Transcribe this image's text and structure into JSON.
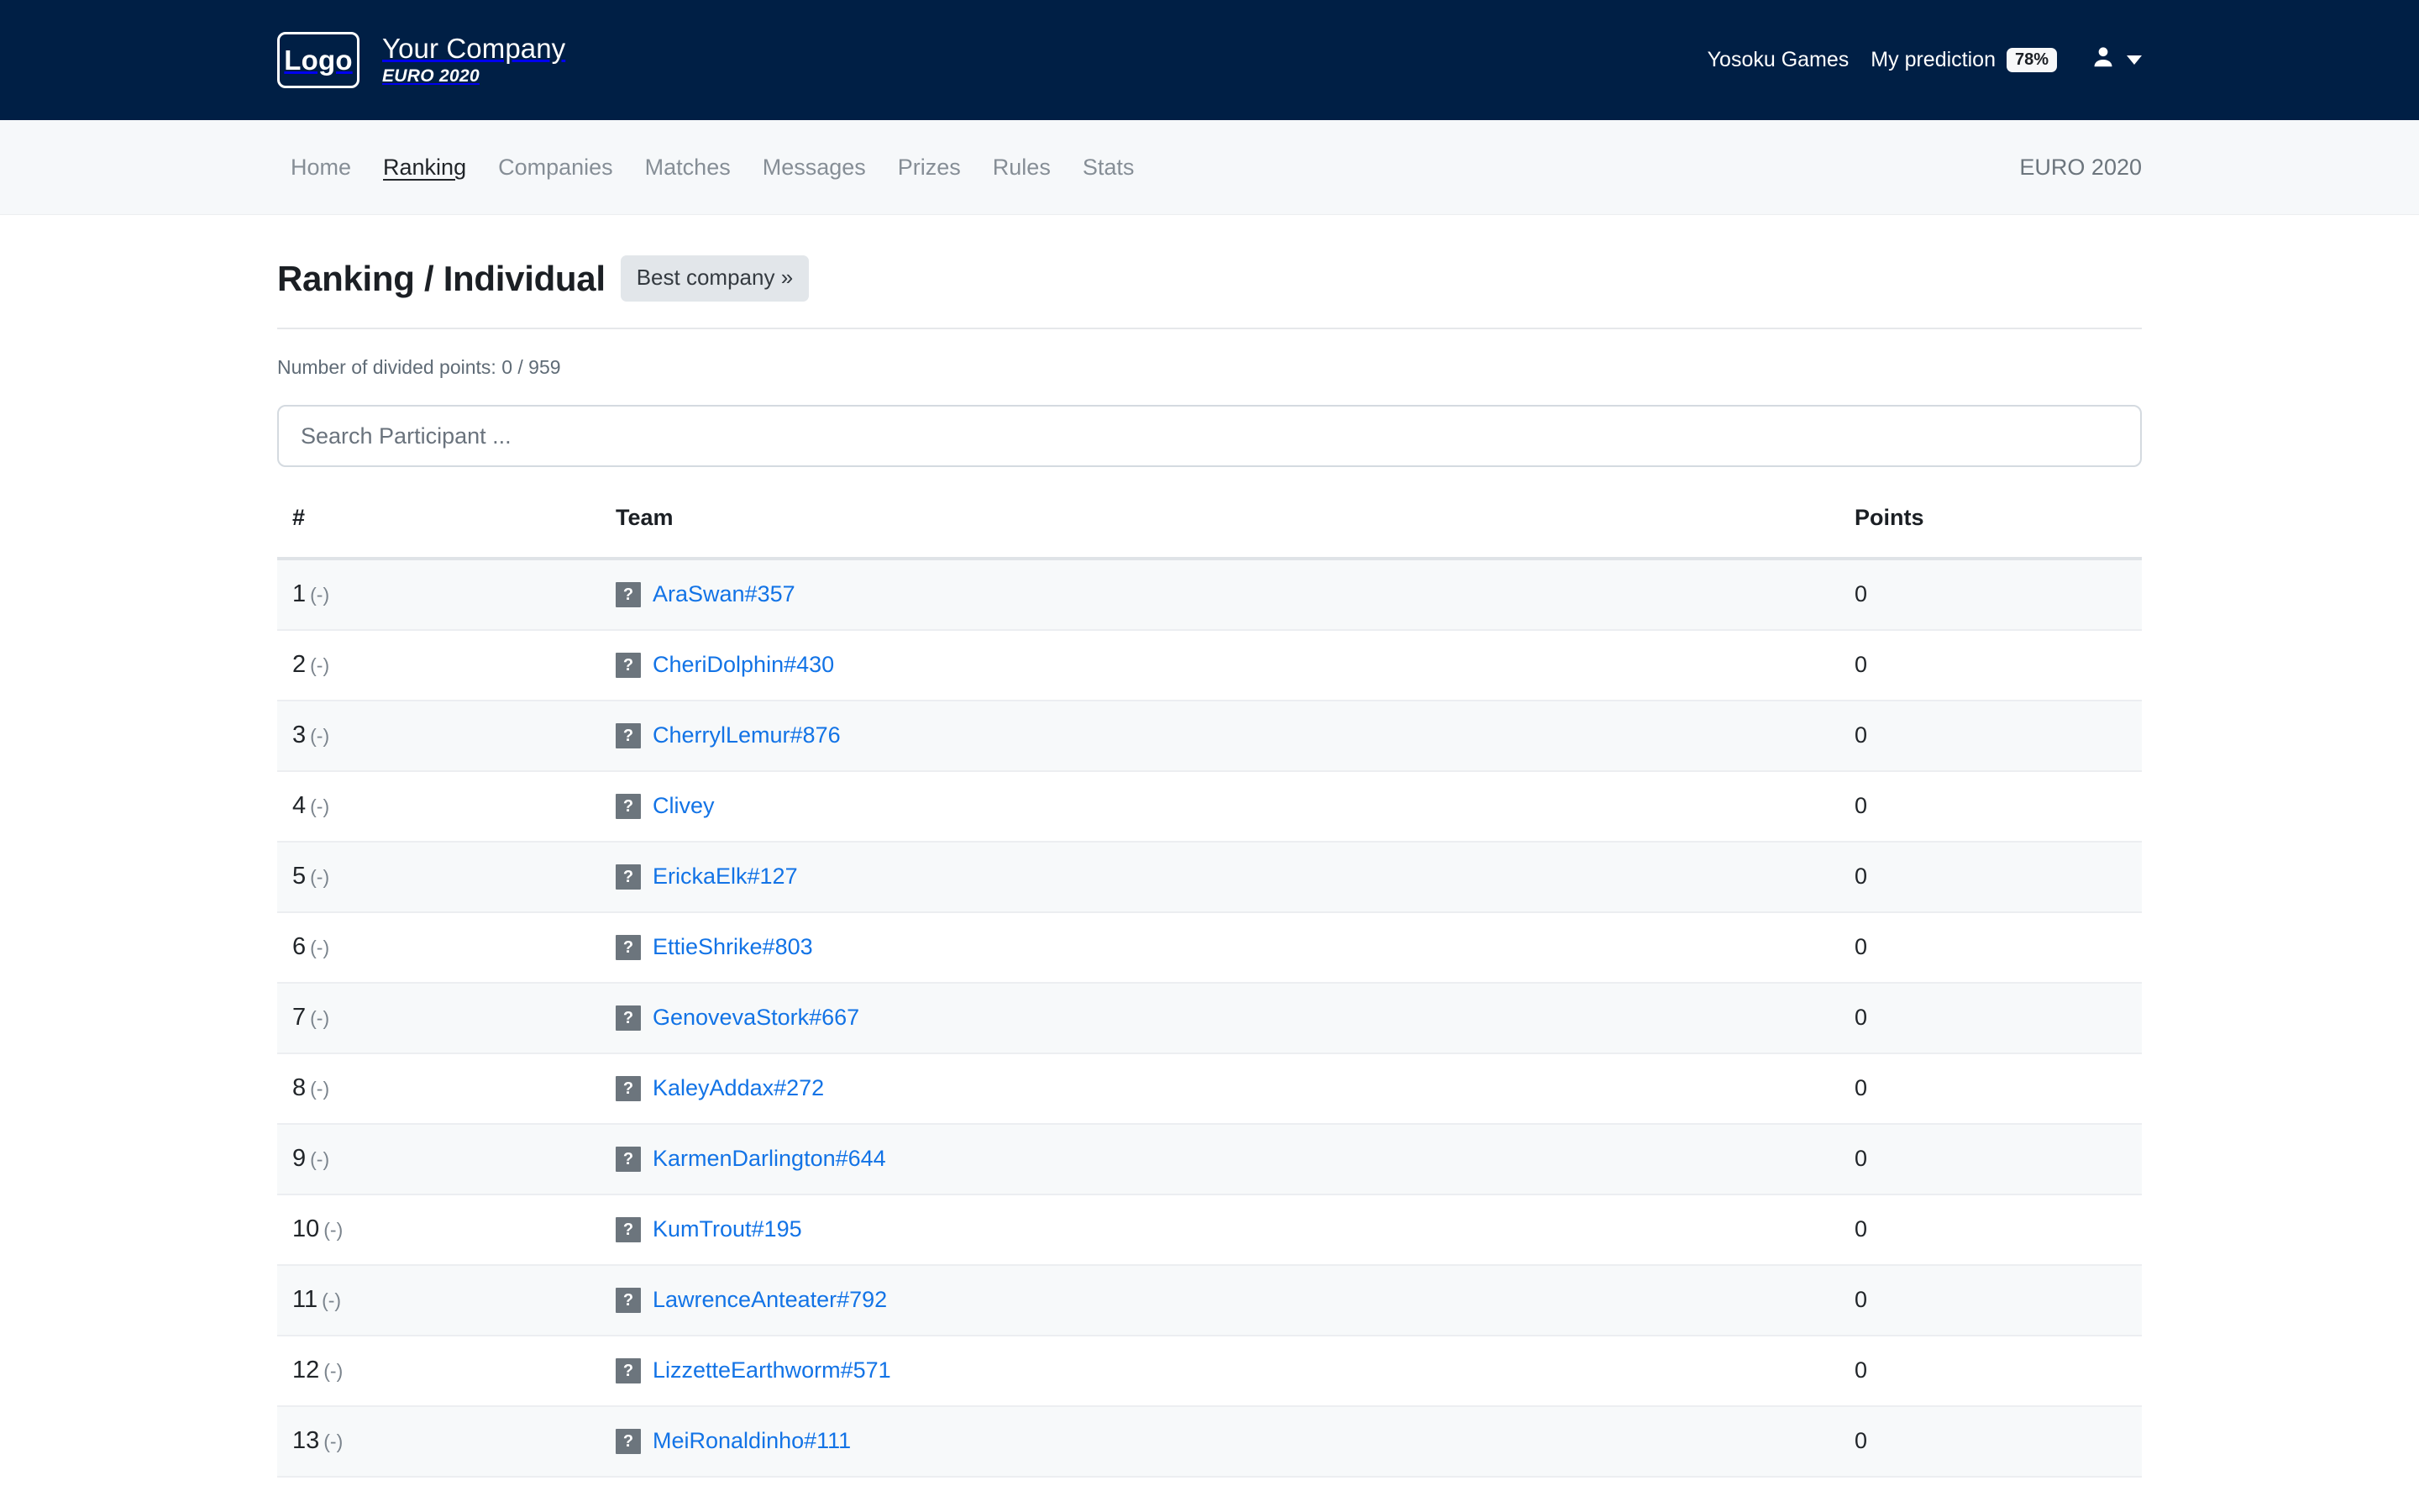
{
  "header": {
    "logo_label": "Logo",
    "company_name": "Your Company",
    "company_sub": "EURO 2020",
    "yosoku_link": "Yosoku Games",
    "prediction_label": "My prediction",
    "prediction_pct": "78%",
    "user_icon": "user-icon",
    "caret_icon": "chevron-down-icon",
    "bg_color": "#001f45"
  },
  "nav": {
    "items": [
      {
        "label": "Home",
        "active": false
      },
      {
        "label": "Ranking",
        "active": true
      },
      {
        "label": "Companies",
        "active": false
      },
      {
        "label": "Matches",
        "active": false
      },
      {
        "label": "Messages",
        "active": false
      },
      {
        "label": "Prizes",
        "active": false
      },
      {
        "label": "Rules",
        "active": false
      },
      {
        "label": "Stats",
        "active": false
      }
    ],
    "right_label": "EURO 2020"
  },
  "main": {
    "page_title": "Ranking / Individual",
    "best_company_button": "Best company »",
    "divided_points_note": "Number of divided points: 0 / 959",
    "search_placeholder": "Search Participant ...",
    "table": {
      "columns": [
        "#",
        "Team",
        "Points"
      ],
      "rows": [
        {
          "rank": "1",
          "delta": "(-)",
          "avatar": "?",
          "team": "AraSwan#357",
          "points": "0"
        },
        {
          "rank": "2",
          "delta": "(-)",
          "avatar": "?",
          "team": "CheriDolphin#430",
          "points": "0"
        },
        {
          "rank": "3",
          "delta": "(-)",
          "avatar": "?",
          "team": "CherrylLemur#876",
          "points": "0"
        },
        {
          "rank": "4",
          "delta": "(-)",
          "avatar": "?",
          "team": "Clivey",
          "points": "0"
        },
        {
          "rank": "5",
          "delta": "(-)",
          "avatar": "?",
          "team": "ErickaElk#127",
          "points": "0"
        },
        {
          "rank": "6",
          "delta": "(-)",
          "avatar": "?",
          "team": "EttieShrike#803",
          "points": "0"
        },
        {
          "rank": "7",
          "delta": "(-)",
          "avatar": "?",
          "team": "GenovevaStork#667",
          "points": "0"
        },
        {
          "rank": "8",
          "delta": "(-)",
          "avatar": "?",
          "team": "KaleyAddax#272",
          "points": "0"
        },
        {
          "rank": "9",
          "delta": "(-)",
          "avatar": "?",
          "team": "KarmenDarlington#644",
          "points": "0"
        },
        {
          "rank": "10",
          "delta": "(-)",
          "avatar": "?",
          "team": "KumTrout#195",
          "points": "0"
        },
        {
          "rank": "11",
          "delta": "(-)",
          "avatar": "?",
          "team": "LawrenceAnteater#792",
          "points": "0"
        },
        {
          "rank": "12",
          "delta": "(-)",
          "avatar": "?",
          "team": "LizzetteEarthworm#571",
          "points": "0"
        },
        {
          "rank": "13",
          "delta": "(-)",
          "avatar": "?",
          "team": "MeiRonaldinho#111",
          "points": "0"
        }
      ]
    }
  },
  "colors": {
    "header_navy": "#001f45",
    "nav_bg": "#f6f8fa",
    "link_blue": "#1273e6",
    "avatar_gray": "#6c757d",
    "row_stripe": "#f7f9fa"
  }
}
